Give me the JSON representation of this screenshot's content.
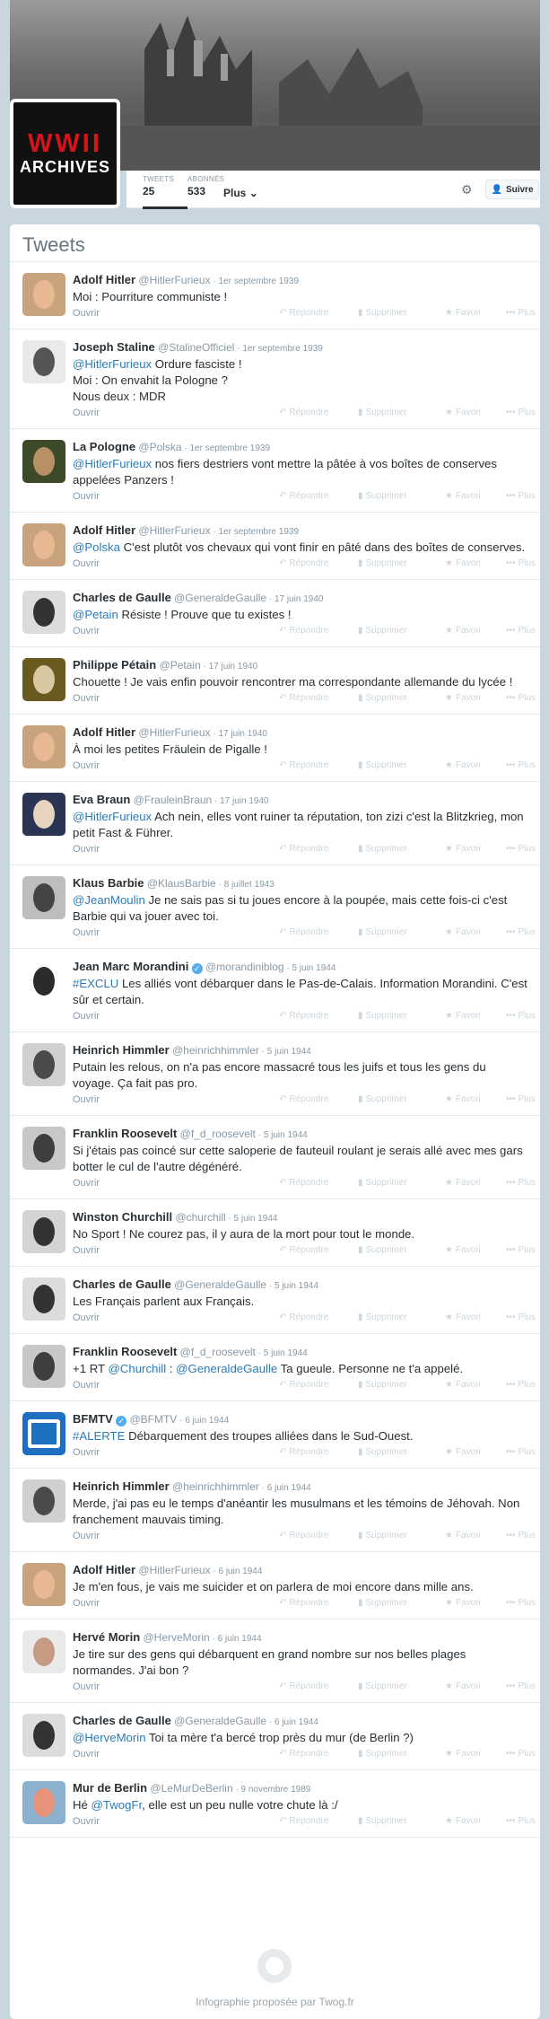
{
  "profile": {
    "logo_line1": "WWII",
    "logo_line2": "ARCHIVES",
    "stats": [
      {
        "label": "TWEETS",
        "value": "25"
      },
      {
        "label": "ABONNÉS",
        "value": "533"
      }
    ],
    "more_label": "Plus",
    "follow_label": "Suivre"
  },
  "timeline": {
    "title": "Tweets",
    "open_label": "Ouvrir",
    "actions": {
      "reply": "Répondre",
      "delete": "Supprimer",
      "favorite": "Favori",
      "more": "Plus"
    },
    "tweets": [
      {
        "name": "Adolf Hitler",
        "handle": "@HitlerFurieux",
        "date": "1er septembre 1939",
        "parts": [
          [
            "",
            "Moi : Pourriture communiste !"
          ]
        ],
        "avatar": "hitler"
      },
      {
        "name": "Joseph Staline",
        "handle": "@StalineOfficiel",
        "date": "1er septembre 1939",
        "parts": [
          [
            "m",
            "@HitlerFurieux"
          ],
          [
            "",
            " Ordure fasciste !\nMoi : On envahit la Pologne ?\nNous deux : MDR"
          ]
        ],
        "avatar": "staline"
      },
      {
        "name": "La Pologne",
        "handle": "@Polska",
        "date": "1er septembre 1939",
        "parts": [
          [
            "m",
            "@HitlerFurieux"
          ],
          [
            "",
            " nos fiers destriers vont mettre la pâtée à vos boîtes de conserves appelées Panzers !"
          ]
        ],
        "avatar": "pologne"
      },
      {
        "name": "Adolf Hitler",
        "handle": "@HitlerFurieux",
        "date": "1er septembre 1939",
        "parts": [
          [
            "m",
            "@Polska"
          ],
          [
            "",
            " C'est plutôt vos chevaux qui vont finir en pâté dans des boîtes de conserves."
          ]
        ],
        "avatar": "hitler"
      },
      {
        "name": "Charles de Gaulle",
        "handle": "@GeneraldeGaulle",
        "date": "17 juin 1940",
        "parts": [
          [
            "m",
            "@Petain"
          ],
          [
            "",
            " Résiste ! Prouve que tu existes !"
          ]
        ],
        "avatar": "degaulle"
      },
      {
        "name": "Philippe Pétain",
        "handle": "@Petain",
        "date": "17 juin 1940",
        "parts": [
          [
            "",
            "Chouette ! Je vais enfin pouvoir rencontrer ma correspondante allemande du lycée !"
          ]
        ],
        "avatar": "petain"
      },
      {
        "name": "Adolf Hitler",
        "handle": "@HitlerFurieux",
        "date": "17 juin 1940",
        "parts": [
          [
            "",
            "À moi les petites Fräulein de Pigalle !"
          ]
        ],
        "avatar": "hitler"
      },
      {
        "name": "Eva Braun",
        "handle": "@FrauleinBraun",
        "date": "17 juin 1940",
        "parts": [
          [
            "m",
            "@HitlerFurieux"
          ],
          [
            "",
            " Ach nein, elles vont ruiner ta réputation, ton zizi c'est la Blitzkrieg, mon petit Fast & Führer."
          ]
        ],
        "avatar": "eva"
      },
      {
        "name": "Klaus Barbie",
        "handle": "@KlausBarbie",
        "date": "8 juillet 1943",
        "parts": [
          [
            "m",
            "@JeanMoulin"
          ],
          [
            "",
            " Je ne sais pas si tu joues encore à la poupée, mais cette fois-ci c'est Barbie qui va jouer avec toi."
          ]
        ],
        "avatar": "barbie"
      },
      {
        "name": "Jean Marc Morandini",
        "handle": "@morandiniblog",
        "date": "5 juin 1944",
        "verified": true,
        "parts": [
          [
            "m",
            "#EXCLU"
          ],
          [
            "",
            " Les alliés vont débarquer dans le Pas-de-Calais. Information Morandini. C'est sûr et certain."
          ]
        ],
        "avatar": "morandini"
      },
      {
        "name": "Heinrich Himmler",
        "handle": "@heinrichhimmler",
        "date": "5 juin 1944",
        "parts": [
          [
            "",
            "Putain les relous, on n'a pas encore massacré tous les juifs et tous les gens du voyage. Ça fait pas pro."
          ]
        ],
        "avatar": "himmler"
      },
      {
        "name": "Franklin Roosevelt",
        "handle": "@f_d_roosevelt",
        "date": "5 juin 1944",
        "parts": [
          [
            "",
            "Si j'étais pas coincé sur cette saloperie de fauteuil roulant je serais allé avec mes gars botter le cul de l'autre dégénéré."
          ]
        ],
        "avatar": "roosevelt"
      },
      {
        "name": "Winston Churchill",
        "handle": "@churchill",
        "date": "5 juin 1944",
        "parts": [
          [
            "",
            "No Sport ! Ne courez pas, il y aura de la mort pour tout le monde."
          ]
        ],
        "avatar": "churchill"
      },
      {
        "name": "Charles de Gaulle",
        "handle": "@GeneraldeGaulle",
        "date": "5 juin 1944",
        "parts": [
          [
            "",
            "Les Français parlent aux Français."
          ]
        ],
        "avatar": "degaulle"
      },
      {
        "name": "Franklin Roosevelt",
        "handle": "@f_d_roosevelt",
        "date": "5 juin 1944",
        "parts": [
          [
            "",
            "+1 RT "
          ],
          [
            "m",
            "@Churchill"
          ],
          [
            "",
            " : "
          ],
          [
            "m",
            "@GeneraldeGaulle"
          ],
          [
            "",
            " Ta gueule. Personne ne t'a appelé."
          ]
        ],
        "avatar": "roosevelt"
      },
      {
        "name": "BFMTV",
        "handle": "@BFMTV",
        "date": "6 juin 1944",
        "verified": true,
        "parts": [
          [
            "m",
            "#ALERTE"
          ],
          [
            "",
            " Débarquement des troupes alliées dans le Sud-Ouest."
          ]
        ],
        "avatar": "bfm"
      },
      {
        "name": "Heinrich Himmler",
        "handle": "@heinrichhimmler",
        "date": "6 juin 1944",
        "parts": [
          [
            "",
            "Merde, j'ai pas eu le temps d'anéantir les musulmans et les témoins de Jéhovah. Non franchement mauvais timing."
          ]
        ],
        "avatar": "himmler"
      },
      {
        "name": "Adolf Hitler",
        "handle": "@HitlerFurieux",
        "date": "6 juin 1944",
        "parts": [
          [
            "",
            "Je m'en fous, je vais me suicider et on parlera de moi encore dans mille ans."
          ]
        ],
        "avatar": "hitler"
      },
      {
        "name": "Hervé Morin",
        "handle": "@HerveMorin",
        "date": "6 juin 1944",
        "parts": [
          [
            "",
            "Je tire sur des gens qui débarquent en grand nombre sur nos belles plages normandes. J'ai bon ?"
          ]
        ],
        "avatar": "morin"
      },
      {
        "name": "Charles de Gaulle",
        "handle": "@GeneraldeGaulle",
        "date": "6 juin 1944",
        "parts": [
          [
            "m",
            "@HerveMorin"
          ],
          [
            "",
            " Toi ta mère t'a bercé trop près du mur (de Berlin ?)"
          ]
        ],
        "avatar": "degaulle"
      },
      {
        "name": "Mur de Berlin",
        "handle": "@LeMurDeBerlin",
        "date": "9 novembre 1989",
        "parts": [
          [
            "",
            "Hé "
          ],
          [
            "m",
            "@TwogFr"
          ],
          [
            "",
            ", elle est un peu nulle votre chute là :/"
          ]
        ],
        "avatar": "mur"
      }
    ],
    "footer_text": "Infographie proposée par Twog.fr"
  },
  "colors": {
    "link": "#2b7bb9",
    "muted": "#8899a6",
    "logo_red": "#d7141a",
    "verified": "#55acee"
  }
}
